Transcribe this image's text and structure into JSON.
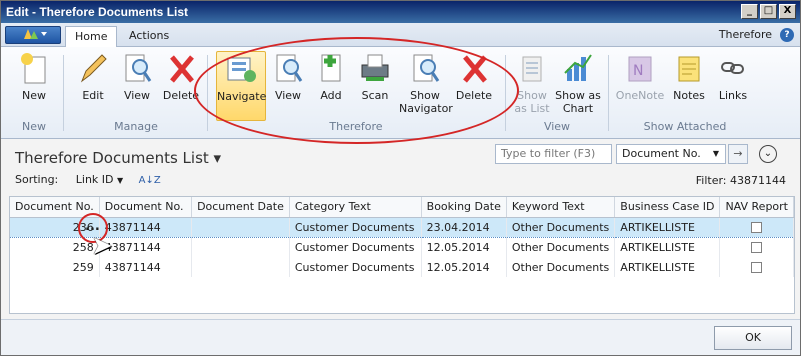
{
  "window": {
    "title": "Edit - Therefore Documents List",
    "min": "_",
    "max": "□",
    "close": "X"
  },
  "tabs": {
    "home": "Home",
    "actions": "Actions",
    "right": "Therefore",
    "help": "?"
  },
  "ribbon": {
    "new": "New",
    "edit": "Edit",
    "view": "View",
    "delete": "Delete",
    "navigate": "Navigate",
    "tview": "View",
    "add": "Add",
    "scan": "Scan",
    "show_nav_1": "Show",
    "show_nav_2": "Navigator",
    "tdelete": "Delete",
    "show_list_1": "Show",
    "show_list_2": "as List",
    "show_chart_1": "Show as",
    "show_chart_2": "Chart",
    "onenote": "OneNote",
    "notes": "Notes",
    "links": "Links",
    "g_new": "New",
    "g_manage": "Manage",
    "g_therefore": "Therefore",
    "g_view": "View",
    "g_show_attached": "Show Attached"
  },
  "list": {
    "title": "Therefore Documents List ▾",
    "filter_placeholder": "Type to filter (F3)",
    "field": "Document No.",
    "sorting_label": "Sorting:",
    "sorting_value": "Link ID",
    "filter_info": "Filter: 43871144"
  },
  "grid": {
    "headers": [
      "Document No.",
      "Document No.",
      "Document Date",
      "Category Text",
      "Booking Date",
      "Keyword Text",
      "Business Case ID",
      "NAV Report"
    ],
    "rows": [
      [
        "236",
        "43871144",
        "",
        "Customer Documents",
        "23.04.2014",
        "Other Documents",
        "ARTIKELLISTE"
      ],
      [
        "258",
        "43871144",
        "",
        "Customer Documents",
        "12.05.2014",
        "Other Documents",
        "ARTIKELLISTE"
      ],
      [
        "259",
        "43871144",
        "",
        "Customer Documents",
        "12.05.2014",
        "Other Documents",
        "ARTIKELLISTE"
      ]
    ],
    "row_button": "..."
  },
  "footer": {
    "ok": "OK"
  }
}
